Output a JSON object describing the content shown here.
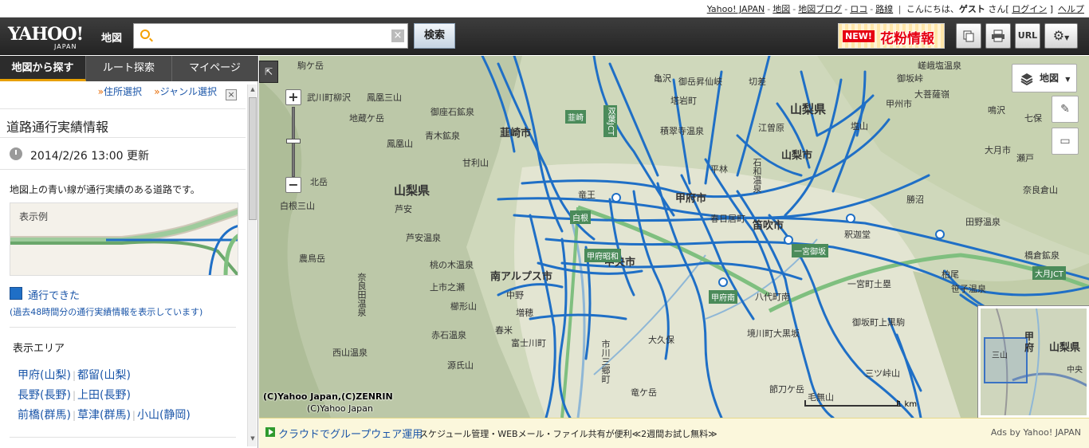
{
  "topstrip": {
    "links": [
      "Yahoo! JAPAN",
      "地図",
      "地図ブログ",
      "ロコ",
      "路線"
    ],
    "greeting_prefix": "こんにちは、",
    "guest": "ゲスト",
    "greeting_suffix": "さん",
    "login": "ログイン",
    "help": "ヘルプ"
  },
  "header": {
    "logo_wordmark": "YAHOO!",
    "logo_japan": "JAPAN",
    "logo_sub": "地図",
    "search_placeholder": "",
    "search_value": "",
    "search_clear": "×",
    "search_button": "検索",
    "promo_new": "NEW!",
    "promo_text": "花粉情報",
    "url_button": "URL"
  },
  "panel": {
    "tabs": [
      "地図から探す",
      "ルート探索",
      "マイページ"
    ],
    "subnav": [
      "住所選択",
      "ジャンル選択"
    ],
    "subnav_arrow": "»",
    "close": "×",
    "title": "道路通行実績情報",
    "updated": "2014/2/26 13:00 更新",
    "description": "地図上の青い線が通行実績のある道路です。",
    "legend_label": "表示例",
    "passed_label": "通行できた",
    "passed_note": "(過去48時間分の通行実績情報を表示しています)",
    "area_title": "表示エリア",
    "area_rows": [
      [
        "甲府(山梨)",
        "都留(山梨)"
      ],
      [
        "長野(長野)",
        "上田(長野)"
      ],
      [
        "前橋(群馬)",
        "草津(群馬)",
        "小山(静岡)"
      ]
    ],
    "area_separator": "|"
  },
  "map": {
    "toggle": "⇱",
    "zoom_in": "+",
    "zoom_out": "−",
    "layer_label": "地図",
    "copyright1": "(C)Yahoo Japan,(C)ZENRIN",
    "copyright2": "(C)Yahoo Japan",
    "scale_label": "1 km",
    "pref_labels": [
      "山梨県",
      "山梨県"
    ],
    "city_labels": [
      "甲府市",
      "韮崎市",
      "南アルプス市",
      "笛吹市",
      "中央市"
    ],
    "places": [
      "駒ケ岳",
      "亀沢",
      "御岳昇仙峡",
      "切差",
      "塔岩町",
      "武川町柳沢",
      "鳳凰三山",
      "地蔵ケ岳",
      "鳳凰山",
      "青木鉱泉",
      "御座石鉱泉",
      "甘利山",
      "積翠寺温泉",
      "江曽原",
      "山梨市",
      "塩山",
      "北岳",
      "白根三山",
      "芦安温泉",
      "桃の木温泉",
      "農鳥岳",
      "奈良田温泉",
      "上市之瀬",
      "櫛形山",
      "赤石温泉",
      "源氏山",
      "大久保",
      "八代町南",
      "一宮町土塁",
      "境川町大黒坂",
      "御坂町上黒駒",
      "節刀ケ岳",
      "竜ケ岳",
      "西山温泉",
      "田野温泉",
      "笹子温泉",
      "橋倉鉱泉",
      "嵯峨塩温泉",
      "竜王",
      "石和温泉",
      "釈迦堂",
      "勝沼",
      "柏尾",
      "春日居町",
      "増穂",
      "富士川町",
      "市川三郷町",
      "芦安",
      "中野",
      "春米",
      "平林",
      "甲府南",
      "一宮御坂",
      "大月JCT",
      "双葉JCT",
      "韮崎",
      "白根",
      "甲府昭和",
      "御坂峠",
      "鳴沢",
      "甲州市",
      "大月市",
      "七保",
      "瀬戸",
      "奈良倉山",
      "大菩薩嶺",
      "三ツ峠山",
      "毛無山"
    ],
    "minimap_pref": "山梨県",
    "minimap_city": "甲府",
    "minimap_label_a": "三山",
    "minimap_label_b": "中央"
  },
  "ad": {
    "link": "クラウドでグループウェア運用",
    "text": "スケジュール管理・WEBメール・ファイル共有が便利≪2週間お試し無料≫",
    "credit": "Ads by Yahoo! JAPAN"
  },
  "colors": {
    "road_blue": "#1f6fc6",
    "header_bg": "#2b2b2b",
    "link_blue": "#1a55a8",
    "accent_orange": "#e8a000",
    "ad_bg": "#fbf7dc"
  }
}
